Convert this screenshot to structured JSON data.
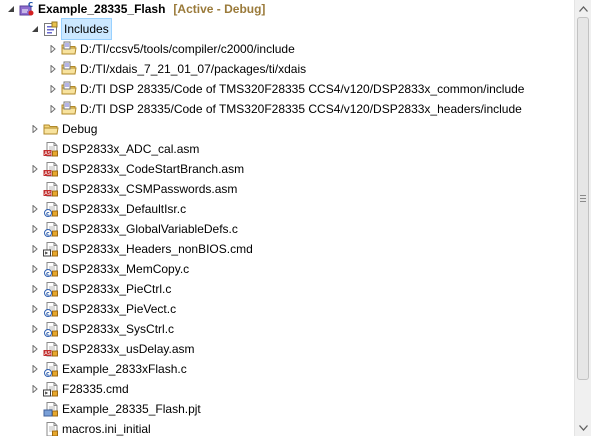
{
  "project": {
    "name": "Example_28335_Flash",
    "status": "[Active - Debug]"
  },
  "includes": {
    "label": "Includes",
    "paths": [
      "D:/TI/ccsv5/tools/compiler/c2000/include",
      "D:/TI/xdais_7_21_01_07/packages/ti/xdais",
      "D:/TI DSP 28335/Code of TMS320F28335 CCS4/v120/DSP2833x_common/include",
      "D:/TI DSP 28335/Code of TMS320F28335 CCS4/v120/DSP2833x_headers/include"
    ]
  },
  "debug_folder": "Debug",
  "files": [
    {
      "name": "DSP2833x_ADC_cal.asm",
      "type": "asm",
      "expandable": false
    },
    {
      "name": "DSP2833x_CodeStartBranch.asm",
      "type": "asm",
      "expandable": true
    },
    {
      "name": "DSP2833x_CSMPasswords.asm",
      "type": "asm",
      "expandable": false
    },
    {
      "name": "DSP2833x_DefaultIsr.c",
      "type": "c",
      "expandable": true
    },
    {
      "name": "DSP2833x_GlobalVariableDefs.c",
      "type": "c",
      "expandable": true
    },
    {
      "name": "DSP2833x_Headers_nonBIOS.cmd",
      "type": "cmd",
      "expandable": true
    },
    {
      "name": "DSP2833x_MemCopy.c",
      "type": "c",
      "expandable": true
    },
    {
      "name": "DSP2833x_PieCtrl.c",
      "type": "c",
      "expandable": true
    },
    {
      "name": "DSP2833x_PieVect.c",
      "type": "c",
      "expandable": true
    },
    {
      "name": "DSP2833x_SysCtrl.c",
      "type": "c",
      "expandable": true
    },
    {
      "name": "DSP2833x_usDelay.asm",
      "type": "asm",
      "expandable": true
    },
    {
      "name": "Example_2833xFlash.c",
      "type": "c",
      "expandable": true
    },
    {
      "name": "F28335.cmd",
      "type": "cmd",
      "expandable": true
    },
    {
      "name": "Example_28335_Flash.pjt",
      "type": "pjt",
      "expandable": false
    },
    {
      "name": "macros.ini_initial",
      "type": "txt",
      "expandable": false
    }
  ]
}
